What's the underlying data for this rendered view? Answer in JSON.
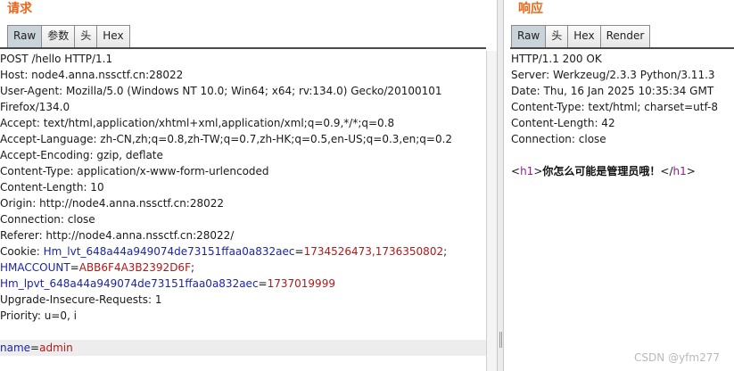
{
  "request": {
    "title": "请求",
    "tabs": [
      "Raw",
      "参数",
      "头",
      "Hex"
    ],
    "active_tab": "Raw",
    "lines": [
      "POST /hello HTTP/1.1",
      "Host: node4.anna.nssctf.cn:28022",
      "User-Agent: Mozilla/5.0 (Windows NT 10.0; Win64; x64; rv:134.0) Gecko/20100101",
      "Firefox/134.0",
      "Accept: text/html,application/xhtml+xml,application/xml;q=0.9,*/*;q=0.8",
      "Accept-Language: zh-CN,zh;q=0.8,zh-TW;q=0.7,zh-HK;q=0.5,en-US;q=0.3,en;q=0.2",
      "Accept-Encoding: gzip, deflate",
      "Content-Type: application/x-www-form-urlencoded",
      "Content-Length: 10",
      "Origin: http://node4.anna.nssctf.cn:28022",
      "Connection: close",
      "Referer: http://node4.anna.nssctf.cn:28022/"
    ],
    "cookie": {
      "prefix": "Cookie: ",
      "k1": "Hm_lvt_648a44a949074de73151ffaa0a832aec",
      "v1": "1734526473,1736350802",
      "sep1": ";",
      "k2": "HMACCOUNT",
      "v2": "ABB6F4A3B2392D6F",
      "sep2": ";",
      "k3": "Hm_lpvt_648a44a949074de73151ffaa0a832aec",
      "v3": "1737019999"
    },
    "lines_after": [
      "Upgrade-Insecure-Requests: 1",
      "Priority: u=0, i"
    ],
    "body": {
      "key": "name",
      "eq": "=",
      "value": "admin"
    }
  },
  "response": {
    "title": "响应",
    "tabs": [
      "Raw",
      "头",
      "Hex",
      "Render"
    ],
    "active_tab": "Raw",
    "lines": [
      "HTTP/1.1 200 OK",
      "Server: Werkzeug/2.3.3 Python/3.11.3",
      "Date: Thu, 16 Jan 2025 10:35:34 GMT",
      "Content-Type: text/html; charset=utf-8",
      "Content-Length: 42",
      "Connection: close"
    ],
    "body": {
      "open_lt": "<",
      "open_tag": "h1",
      "open_gt": ">",
      "text": "你怎么可能是管理员哦！",
      "close_lt": "</",
      "close_tag": "h1",
      "close_gt": ">"
    }
  },
  "watermark": "CSDN @yfm277"
}
